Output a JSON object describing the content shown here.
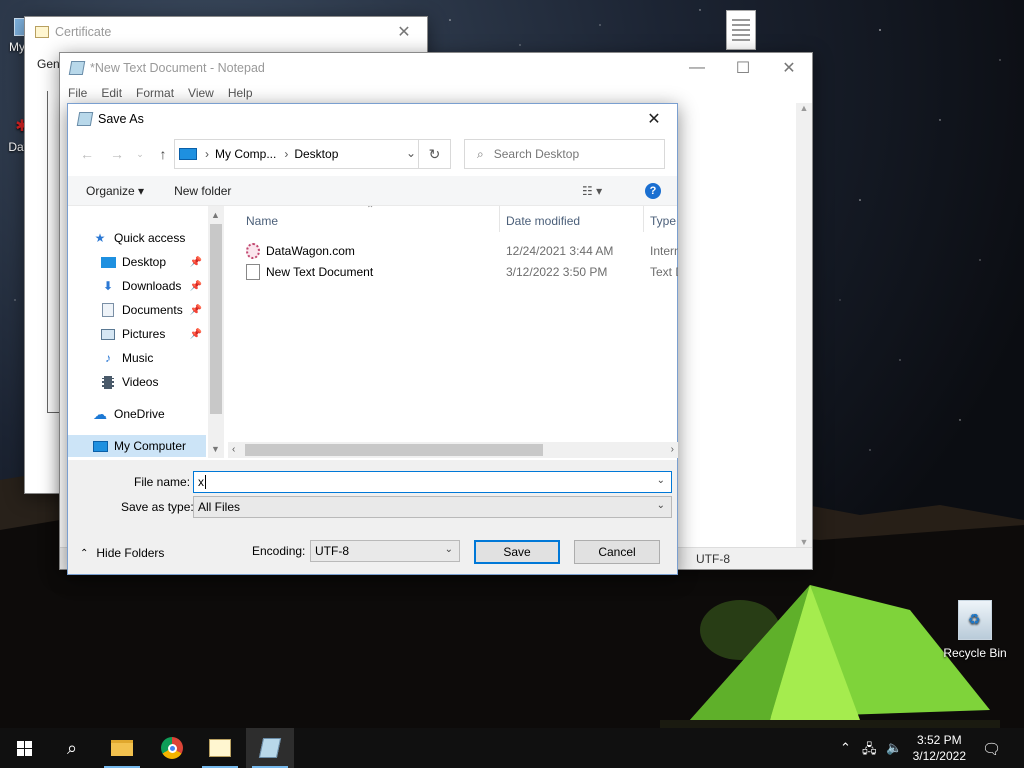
{
  "desktop": {
    "icons": [
      {
        "label": "My C"
      },
      {
        "label": "Data"
      }
    ],
    "recycle_bin": "Recycle Bin"
  },
  "certificate_window": {
    "title": "Certificate",
    "tab_partial": "Gene"
  },
  "notepad": {
    "title": "*New Text Document - Notepad",
    "menu": [
      "File",
      "Edit",
      "Format",
      "View",
      "Help"
    ],
    "status_encoding": "UTF-8"
  },
  "save_as": {
    "title": "Save As",
    "breadcrumb": [
      "My Comp...",
      "Desktop"
    ],
    "search_placeholder": "Search Desktop",
    "toolbar": {
      "organize": "Organize",
      "new_folder": "New folder"
    },
    "nav": [
      {
        "label": "Quick access",
        "icon": "star-icon"
      },
      {
        "label": "Desktop",
        "icon": "desktop-folder-icon",
        "pinned": true
      },
      {
        "label": "Downloads",
        "icon": "download-arrow-icon",
        "pinned": true
      },
      {
        "label": "Documents",
        "icon": "documents-icon",
        "pinned": true
      },
      {
        "label": "Pictures",
        "icon": "pictures-icon",
        "pinned": true
      },
      {
        "label": "Music",
        "icon": "music-note-icon"
      },
      {
        "label": "Videos",
        "icon": "film-icon"
      },
      {
        "label": "OneDrive",
        "icon": "cloud-icon"
      },
      {
        "label": "My Computer",
        "icon": "computer-icon",
        "selected": true
      }
    ],
    "columns": [
      "Name",
      "Date modified",
      "Type"
    ],
    "files": [
      {
        "name": "DataWagon.com",
        "date": "12/24/2021 3:44 AM",
        "type": "Intern",
        "icon": "internet-shortcut-icon"
      },
      {
        "name": "New Text Document",
        "date": "3/12/2022 3:50 PM",
        "type": "Text D",
        "icon": "text-file-icon"
      }
    ],
    "file_name_label": "File name:",
    "file_name_value": "x",
    "save_as_type_label": "Save as type:",
    "save_as_type_value": "All Files",
    "hide_folders": "Hide Folders",
    "encoding_label": "Encoding:",
    "encoding_value": "UTF-8",
    "save_button": "Save",
    "cancel_button": "Cancel"
  },
  "taskbar": {
    "time": "3:52 PM",
    "date": "3/12/2022"
  },
  "colors": {
    "accent": "#0078d7",
    "selection": "#cce4f7",
    "taskbar": "#101010"
  }
}
